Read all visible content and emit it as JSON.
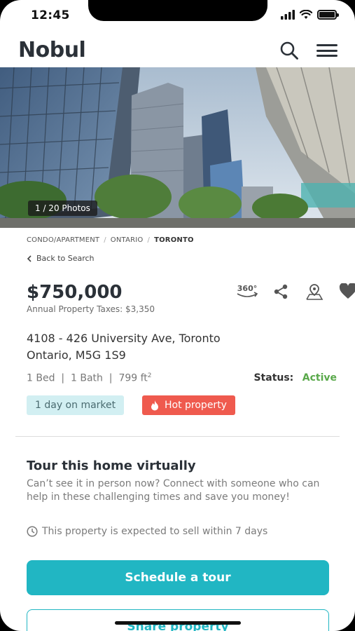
{
  "status_bar": {
    "time": "12:45"
  },
  "header": {
    "logo_text": "Nobul"
  },
  "hero": {
    "photo_count": "1 / 20 Photos"
  },
  "breadcrumb": {
    "items": [
      "CONDO/APARTMENT",
      "ONTARIO",
      "TORONTO"
    ]
  },
  "back_link": "Back to Search",
  "listing": {
    "price": "$750,000",
    "taxes": "Annual Property Taxes: $3,350",
    "address_line1": "4108 - 426 University Ave, Toronto",
    "address_line2": "Ontario, M5G 1S9",
    "beds": "1 Bed",
    "baths": "1 Bath",
    "sqft": "799 ft",
    "sqft_sup": "2",
    "status_label": "Status:",
    "status_value": "Active",
    "chip_days": "1 day on market",
    "chip_hot": "Hot property"
  },
  "actions": {
    "tour_360_label": "360°",
    "icons": [
      "360-view-icon",
      "share-icon",
      "map-pin-icon",
      "heart-icon"
    ]
  },
  "tour": {
    "title": "Tour this home virtually",
    "description": "Can’t see it in person now? Connect with someone who can help in these challenging times and save you money!",
    "sell_note": "This property is expected to sell within 7 days",
    "schedule_button": "Schedule a tour",
    "share_button": "Share property"
  },
  "colors": {
    "accent": "#21b6c3",
    "hot": "#ef5a4e",
    "active": "#5aa94b",
    "days_chip_bg": "#d2eff2"
  }
}
